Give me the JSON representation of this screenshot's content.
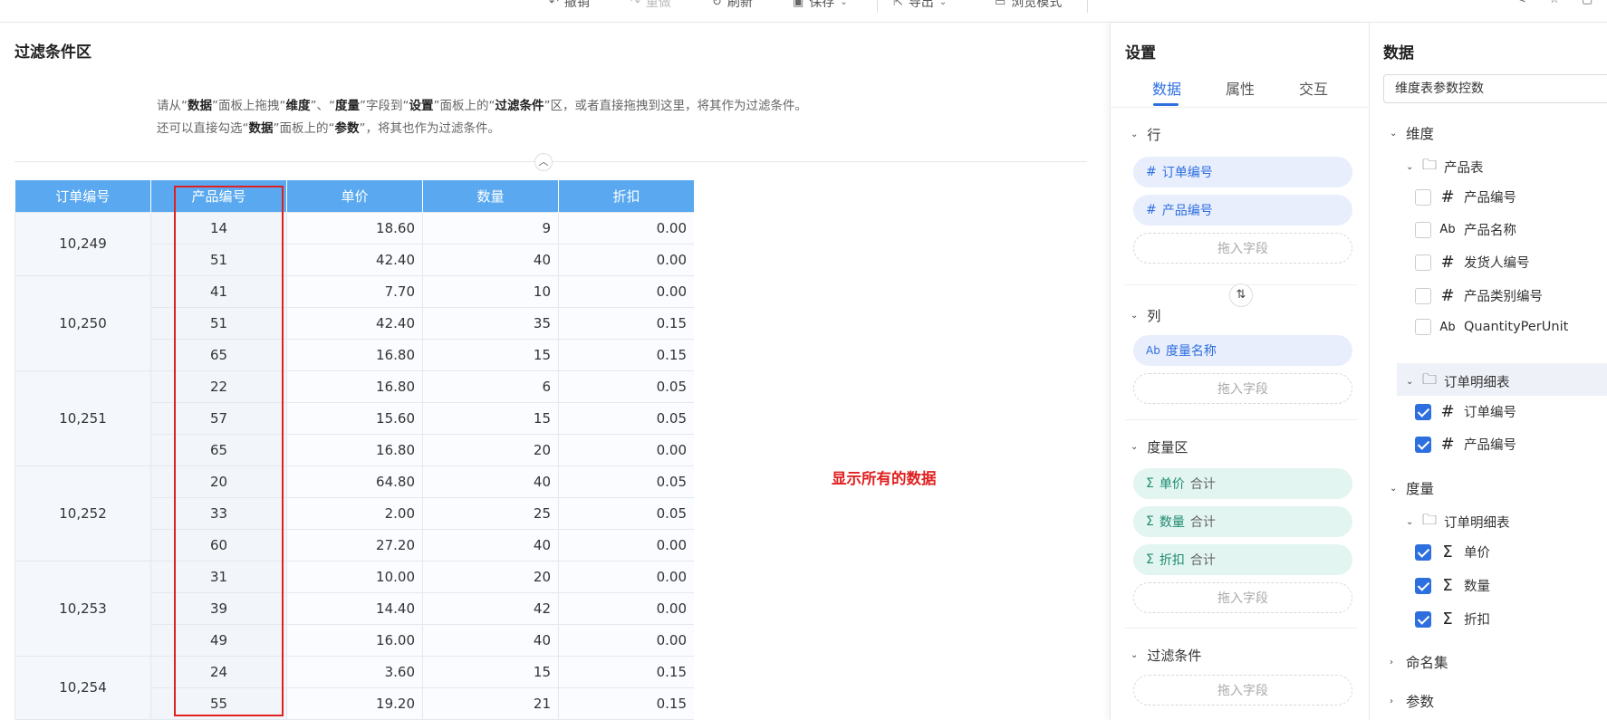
{
  "toolbar": {
    "undo": "撤销",
    "redo": "重做",
    "refresh": "刷新",
    "save": "保存",
    "export": "导出",
    "browse": "浏览模式"
  },
  "filter_area": {
    "title": "过滤条件区",
    "hint1": {
      "a": "请从“",
      "b": "数据",
      "c": "”面板上拖拽“",
      "d": "维度",
      "e": "”、“",
      "f": "度量",
      "g": "”字段到“",
      "h": "设置",
      "i": "”面板上的“",
      "j": "过滤条件",
      "k": "”区，或者直接拖拽到这里，将其作为过滤条件。"
    },
    "hint2": {
      "a": "还可以直接勾选“",
      "b": "数据",
      "c": "”面板上的“",
      "d": "参数",
      "e": "”，将其也作为过滤条件。"
    },
    "message": "显示所有的数据"
  },
  "table": {
    "headers": [
      "订单编号",
      "产品编号",
      "单价",
      "数量",
      "折扣"
    ],
    "groups": [
      {
        "order": "10,249",
        "rows": [
          [
            "14",
            "18.60",
            "9",
            "0.00"
          ],
          [
            "51",
            "42.40",
            "40",
            "0.00"
          ]
        ]
      },
      {
        "order": "10,250",
        "rows": [
          [
            "41",
            "7.70",
            "10",
            "0.00"
          ],
          [
            "51",
            "42.40",
            "35",
            "0.15"
          ],
          [
            "65",
            "16.80",
            "15",
            "0.15"
          ]
        ]
      },
      {
        "order": "10,251",
        "rows": [
          [
            "22",
            "16.80",
            "6",
            "0.05"
          ],
          [
            "57",
            "15.60",
            "15",
            "0.05"
          ],
          [
            "65",
            "16.80",
            "20",
            "0.00"
          ]
        ]
      },
      {
        "order": "10,252",
        "rows": [
          [
            "20",
            "64.80",
            "40",
            "0.05"
          ],
          [
            "33",
            "2.00",
            "25",
            "0.05"
          ],
          [
            "60",
            "27.20",
            "40",
            "0.00"
          ]
        ]
      },
      {
        "order": "10,253",
        "rows": [
          [
            "31",
            "10.00",
            "20",
            "0.00"
          ],
          [
            "39",
            "14.40",
            "42",
            "0.00"
          ],
          [
            "49",
            "16.00",
            "40",
            "0.00"
          ]
        ]
      },
      {
        "order": "10,254",
        "rows": [
          [
            "24",
            "3.60",
            "15",
            "0.15"
          ],
          [
            "55",
            "19.20",
            "21",
            "0.15"
          ]
        ]
      }
    ]
  },
  "settings": {
    "title": "设置",
    "tabs": [
      "数据",
      "属性",
      "交互"
    ],
    "rows_label": "行",
    "row_fields": [
      "订单编号",
      "产品编号"
    ],
    "drop_label": "拖入字段",
    "cols_label": "列",
    "col_fields": [
      "度量名称"
    ],
    "measures_label": "度量区",
    "measure_fields": [
      {
        "name": "单价",
        "agg": "合计"
      },
      {
        "name": "数量",
        "agg": "合计"
      },
      {
        "name": "折扣",
        "agg": "合计"
      }
    ],
    "filter_label": "过滤条件"
  },
  "data_panel": {
    "title": "数据",
    "selected": "维度表参数控数",
    "dimensions_label": "维度",
    "product_table": "产品表",
    "product_fields": [
      {
        "name": "产品编号",
        "type": "#",
        "checked": false
      },
      {
        "name": "产品名称",
        "type": "Ab",
        "checked": false
      },
      {
        "name": "发货人编号",
        "type": "#",
        "checked": false
      },
      {
        "name": "产品类别编号",
        "type": "#",
        "checked": false
      },
      {
        "name": "QuantityPerUnit",
        "type": "Ab",
        "checked": false
      }
    ],
    "order_detail_table": "订单明细表",
    "order_detail_fields": [
      {
        "name": "订单编号",
        "type": "#",
        "checked": true
      },
      {
        "name": "产品编号",
        "type": "#",
        "checked": true
      }
    ],
    "measures_label": "度量",
    "measure_table": "订单明细表",
    "measure_fields": [
      {
        "name": "单价",
        "type": "Σ",
        "checked": true
      },
      {
        "name": "数量",
        "type": "Σ",
        "checked": true
      },
      {
        "name": "折扣",
        "type": "Σ",
        "checked": true
      }
    ],
    "named_sets_label": "命名集",
    "params_label": "参数"
  }
}
